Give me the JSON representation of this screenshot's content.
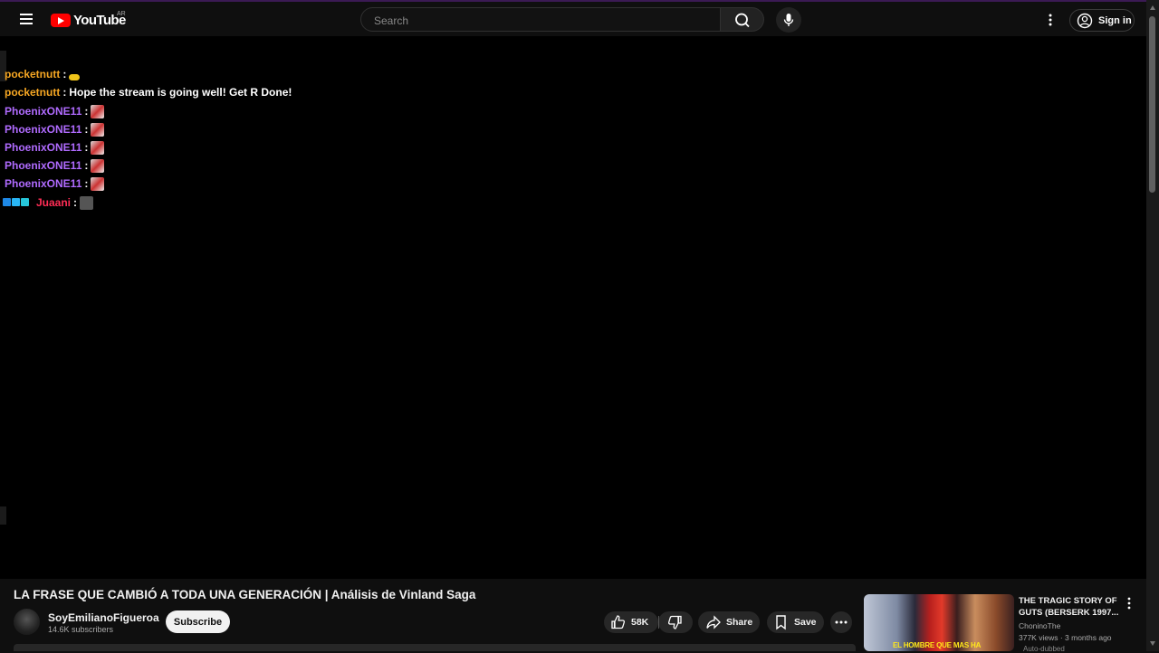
{
  "header": {
    "logo_text": "YouTube",
    "country_code": "AR",
    "search_placeholder": "Search",
    "signin_label": "Sign in"
  },
  "chat": {
    "messages": [
      {
        "author": "pocketnutt",
        "author_color": "#f5a623",
        "text": "",
        "emote": "pepe-emote"
      },
      {
        "author": "pocketnutt",
        "author_color": "#f5a623",
        "text": "Hope the stream is going well! Get R Done!",
        "emote": ""
      },
      {
        "author": "PhoenixONE11",
        "author_color": "#b06bff",
        "text": "",
        "emote": "phoenix-emote"
      },
      {
        "author": "PhoenixONE11",
        "author_color": "#b06bff",
        "text": "",
        "emote": "phoenix-emote"
      },
      {
        "author": "PhoenixONE11",
        "author_color": "#b06bff",
        "text": "",
        "emote": "phoenix-emote"
      },
      {
        "author": "PhoenixONE11",
        "author_color": "#b06bff",
        "text": "",
        "emote": "phoenix-emote"
      },
      {
        "author": "PhoenixONE11",
        "author_color": "#b06bff",
        "text": "",
        "emote": "phoenix-emote"
      },
      {
        "author": "Juaani",
        "author_color": "#ff2d55",
        "text": "",
        "emote": "gray-emote"
      }
    ],
    "separator": ":"
  },
  "video": {
    "title": "LA FRASE QUE CAMBIÓ A TODA UNA GENERACIÓN | Análisis de Vinland Saga",
    "channel_name": "SoyEmilianoFigueroa",
    "subscriber_count": "14.6K subscribers",
    "subscribe_label": "Subscribe",
    "like_count": "58K",
    "share_label": "Share",
    "save_label": "Save"
  },
  "recommended": {
    "title": "THE TRAGIC STORY OF GUTS (BERSERK 1997...",
    "channel": "ChoninoThe",
    "meta": "377K views · 3 months ago",
    "extra": "Auto-dubbed",
    "thumb_text": "EL HOMBRE QUE MAS HA"
  },
  "colors": {
    "background": "#0f0f0f",
    "brand_red": "#ff0000",
    "subscribe_bg": "#f1f1f1"
  }
}
